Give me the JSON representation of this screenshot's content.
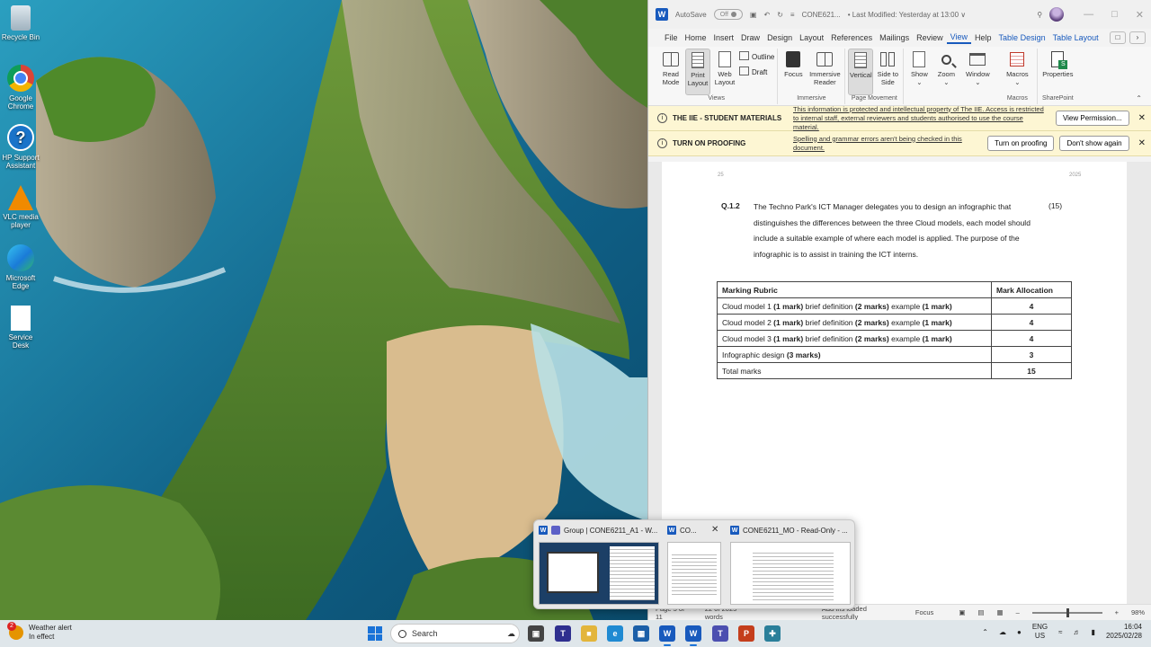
{
  "desktop": {
    "icons": [
      {
        "label": "Recycle Bin",
        "icon": "recycle-bin-icon"
      },
      {
        "label": "Google Chrome",
        "icon": "chrome-icon"
      },
      {
        "label": "HP Support Assistant",
        "icon": "help-icon"
      },
      {
        "label": "VLC media player",
        "icon": "vlc-icon"
      },
      {
        "label": "Microsoft Edge",
        "icon": "edge-icon"
      },
      {
        "label": "Service Desk",
        "icon": "file-icon"
      }
    ]
  },
  "word": {
    "title": {
      "autosave_label": "AutoSave",
      "autosave_state": "Off",
      "doc_name": "CONE621...",
      "modified": "• Last Modified: Yesterday at 13:00 ∨"
    },
    "menu": {
      "tabs": [
        "File",
        "Home",
        "Insert",
        "Draw",
        "Design",
        "Layout",
        "References",
        "Mailings",
        "Review",
        "View",
        "Help",
        "Table Design",
        "Table Layout"
      ],
      "active_tab": "View"
    },
    "ribbon": {
      "views": {
        "label": "Views",
        "read_mode": "Read Mode",
        "print_layout": "Print Layout",
        "web_layout": "Web Layout",
        "outline": "Outline",
        "draft": "Draft"
      },
      "immersive": {
        "label": "Immersive",
        "focus": "Focus",
        "immersive_reader": "Immersive Reader"
      },
      "page_movement": {
        "label": "Page Movement",
        "vertical": "Vertical",
        "side_to_side": "Side to Side"
      },
      "show": "Show",
      "zoom": "Zoom",
      "window": "Window",
      "macros": {
        "label": "Macros",
        "button": "Macros"
      },
      "sharepoint": {
        "label": "SharePoint",
        "button": "Properties"
      }
    },
    "info_bars": [
      {
        "title": "THE IIE - STUDENT MATERIALS",
        "message": "This information is protected and intellectual property of The IIE. Access is restricted to internal staff, external reviewers and students authorised to use the course material.",
        "button": "View Permission..."
      },
      {
        "title": "TURN ON PROOFING",
        "message": "Spelling and grammar errors aren't being checked in this document.",
        "button": "Turn on proofing",
        "button2": "Don't show again"
      }
    ],
    "doc": {
      "header_left": "25",
      "header_right": "2025",
      "question_number": "Q.1.2",
      "question_text": "The Techno Park's ICT Manager delegates you to design an infographic that distinguishes the differences between the three Cloud models, each model should include a suitable example of where each model is applied. The purpose of the infographic is to assist in training the ICT interns.",
      "question_marks": "(15)",
      "rubric": {
        "headers": [
          "Marking Rubric",
          "Mark Allocation"
        ],
        "rows": [
          {
            "a": "Cloud model 1 ",
            "b": "(1 mark)",
            "c": " brief definition ",
            "d": "(2 marks)",
            "e": " example ",
            "f": "(1 mark)",
            "mark": "4"
          },
          {
            "a": "Cloud model 2 ",
            "b": "(1 mark)",
            "c": " brief definition ",
            "d": "(2 marks)",
            "e": " example ",
            "f": "(1 mark)",
            "mark": "4"
          },
          {
            "a": "Cloud model 3 ",
            "b": "(1 mark)",
            "c": " brief definition ",
            "d": "(2 marks)",
            "e": " example ",
            "f": "(1 mark)",
            "mark": "4"
          },
          {
            "a": "Infographic design ",
            "b": "(3 marks)",
            "c": "",
            "d": "",
            "e": "",
            "f": "",
            "mark": "3"
          },
          {
            "a": "Total marks",
            "b": "",
            "c": "",
            "d": "",
            "e": "",
            "f": "",
            "mark": "15"
          }
        ]
      }
    },
    "status": {
      "page": "Page 5 of 11",
      "words": "22 of 2025 words",
      "addin": "Add-ins loaded successfully",
      "focus": "Focus",
      "zoom": "98%"
    }
  },
  "thumbnails": [
    {
      "title": "Group | CONE6211_A1 - W..."
    },
    {
      "title": "CO..."
    },
    {
      "title": "CONE6211_MO - Read-Only - ..."
    }
  ],
  "taskbar": {
    "weather_title": "Weather alert",
    "weather_sub": "In effect",
    "weather_badge": "2",
    "search_label": "Search",
    "lang_top": "ENG",
    "lang_bottom": "US",
    "time": "16:04",
    "date": "2025/02/28"
  },
  "colors": {
    "accent": "#185abd",
    "infobar": "#fdf6d3",
    "taskbar": "#dfe6ea"
  }
}
